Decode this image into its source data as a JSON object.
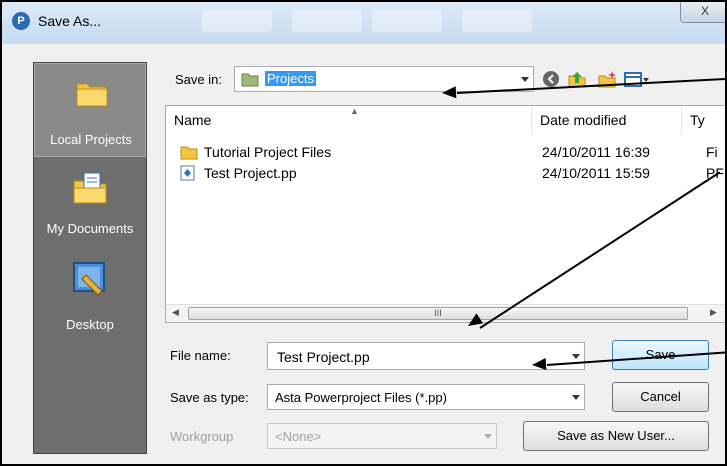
{
  "window": {
    "title": "Save As...",
    "app_icon_glyph": "P",
    "close_glyph": "X"
  },
  "places": [
    {
      "label": "Local Projects",
      "icon": "folder-icon",
      "active": true
    },
    {
      "label": "My Documents",
      "icon": "documents-folder-icon",
      "active": false
    },
    {
      "label": "Desktop",
      "icon": "desktop-icon",
      "active": false
    }
  ],
  "save_in": {
    "label": "Save in:",
    "value": "Projects",
    "toolbar_icons": [
      "back-icon",
      "up-folder-icon",
      "new-folder-icon",
      "view-menu-icon"
    ]
  },
  "file_list": {
    "columns": [
      "Name",
      "Date modified",
      "Ty"
    ],
    "rows": [
      {
        "name": "Tutorial Project Files",
        "date": "24/10/2011 16:39",
        "type": "Fi",
        "icon": "folder-icon"
      },
      {
        "name": "Test Project.pp",
        "date": "24/10/2011 15:59",
        "type": "PF",
        "icon": "project-file-icon"
      }
    ],
    "scroll_thumb_glyph": "III"
  },
  "file_name": {
    "label": "File name:",
    "value": "Test Project.pp"
  },
  "save_as_type": {
    "label": "Save as type:",
    "value": "Asta Powerproject Files (*.pp)"
  },
  "workgroup": {
    "label": "Workgroup",
    "value": "<None>"
  },
  "buttons": {
    "save": "Save",
    "cancel": "Cancel",
    "save_as_new_user": "Save as New User..."
  }
}
